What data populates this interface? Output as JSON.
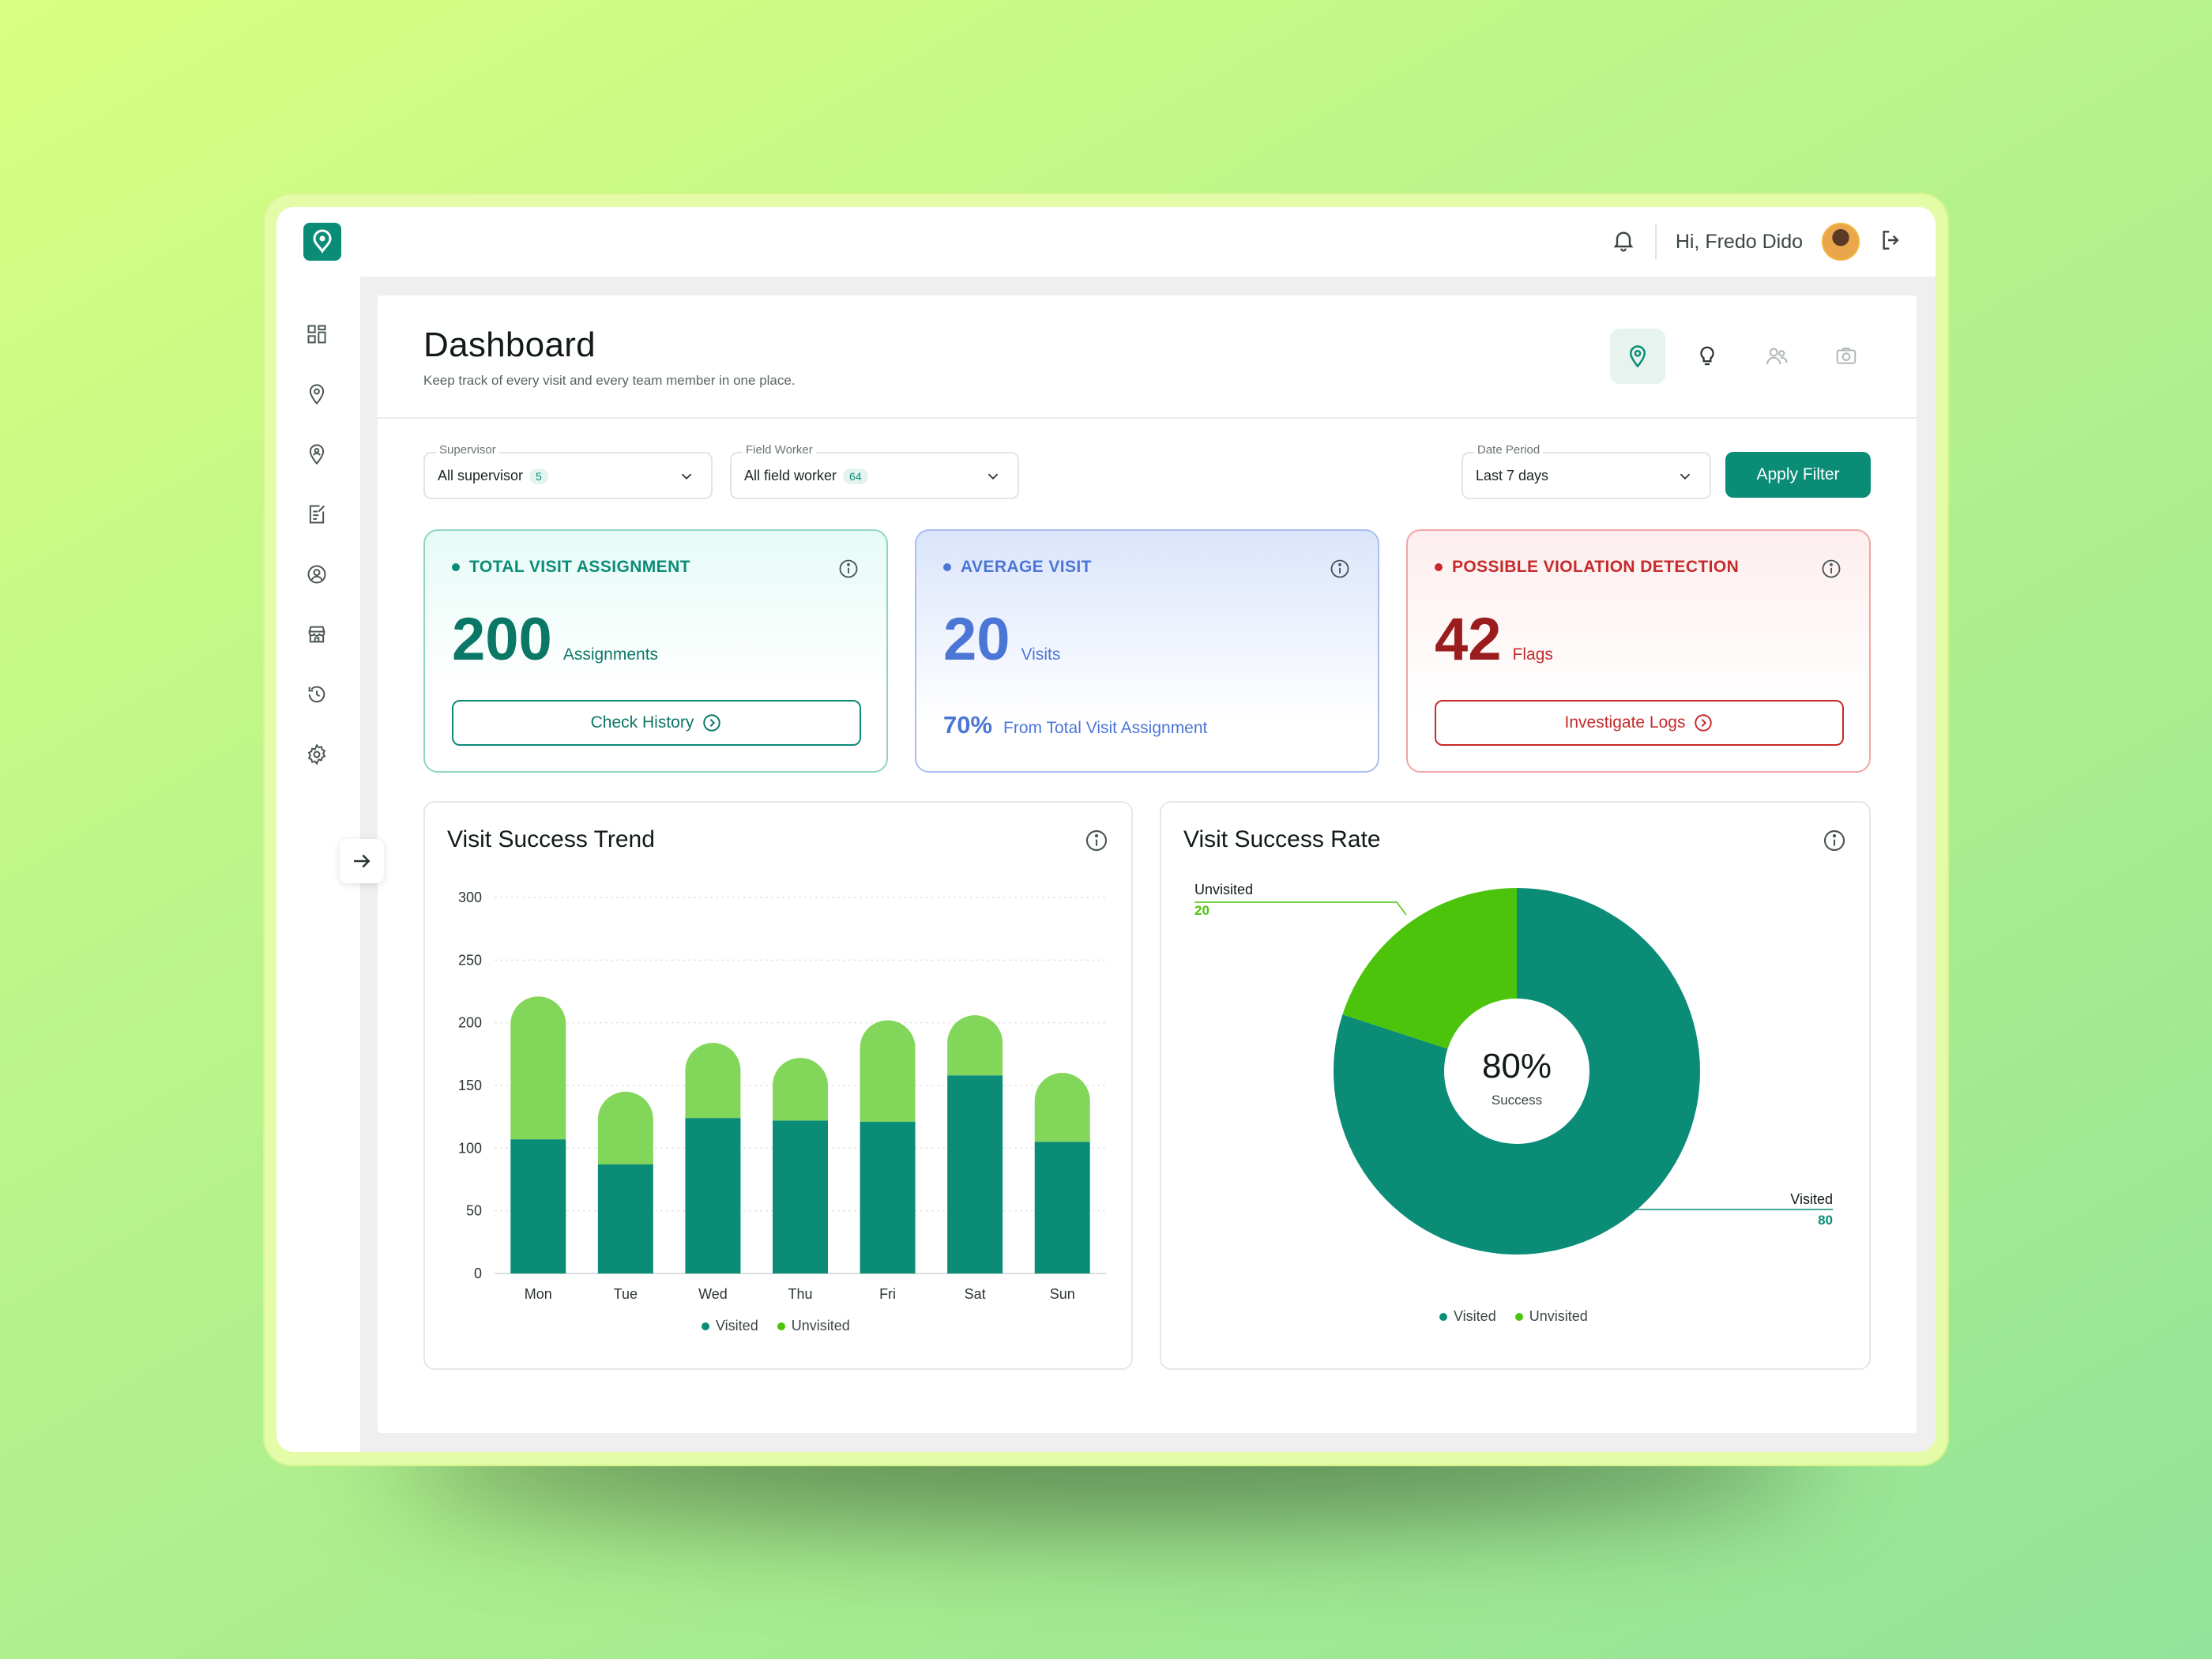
{
  "topbar": {
    "greeting": "Hi, Fredo Dido"
  },
  "header": {
    "title": "Dashboard",
    "subtitle": "Keep track of every visit and every team member in one place."
  },
  "filters": {
    "supervisor": {
      "label": "Supervisor",
      "value": "All supervisor",
      "count": "5"
    },
    "field_worker": {
      "label": "Field Worker",
      "value": "All field worker",
      "count": "64"
    },
    "date_period": {
      "label": "Date Period",
      "value": "Last 7 days"
    },
    "apply_label": "Apply Filter"
  },
  "cards": {
    "total": {
      "title": "TOTAL VISIT ASSIGNMENT",
      "value": "200",
      "unit": "Assignments",
      "button": "Check History",
      "color": "#0b8c77"
    },
    "average": {
      "title": "AVERAGE VISIT",
      "value": "20",
      "unit": "Visits",
      "percent": "70%",
      "percent_label": "From Total Visit Assignment",
      "color": "#4c76d6"
    },
    "violation": {
      "title": "POSSIBLE VIOLATION DETECTION",
      "value": "42",
      "unit": "Flags",
      "button": "Investigate Logs",
      "color": "#c62a2a",
      "value_color": "#9b1c1c"
    }
  },
  "trend": {
    "title": "Visit Success Trend"
  },
  "rate": {
    "title": "Visit Success Rate",
    "center_value": "80%",
    "center_label": "Success",
    "callouts": {
      "unvisited_label": "Unvisited",
      "unvisited_value": "20",
      "visited_label": "Visited",
      "visited_value": "80"
    }
  },
  "colors": {
    "visited": "#0b8c77",
    "unvisited": "#4cc40c",
    "unvisited_bar": "#82d65a"
  },
  "chart_data": [
    {
      "type": "bar",
      "stacked": true,
      "title": "Visit Success Trend",
      "categories": [
        "Mon",
        "Tue",
        "Wed",
        "Thu",
        "Fri",
        "Sat",
        "Sun"
      ],
      "series": [
        {
          "name": "Visited",
          "values": [
            107,
            87,
            124,
            122,
            121,
            158,
            105
          ]
        },
        {
          "name": "Unvisited",
          "values": [
            114,
            58,
            60,
            50,
            81,
            48,
            55
          ]
        }
      ],
      "ylim": [
        0,
        300
      ],
      "yticks": [
        0,
        50,
        100,
        150,
        200,
        250,
        300
      ],
      "grid": true,
      "legend": "bottom-center"
    },
    {
      "type": "pie",
      "title": "Visit Success Rate",
      "labels": [
        "Visited",
        "Unvisited"
      ],
      "values": [
        80,
        20
      ],
      "legend": "bottom-center"
    }
  ]
}
